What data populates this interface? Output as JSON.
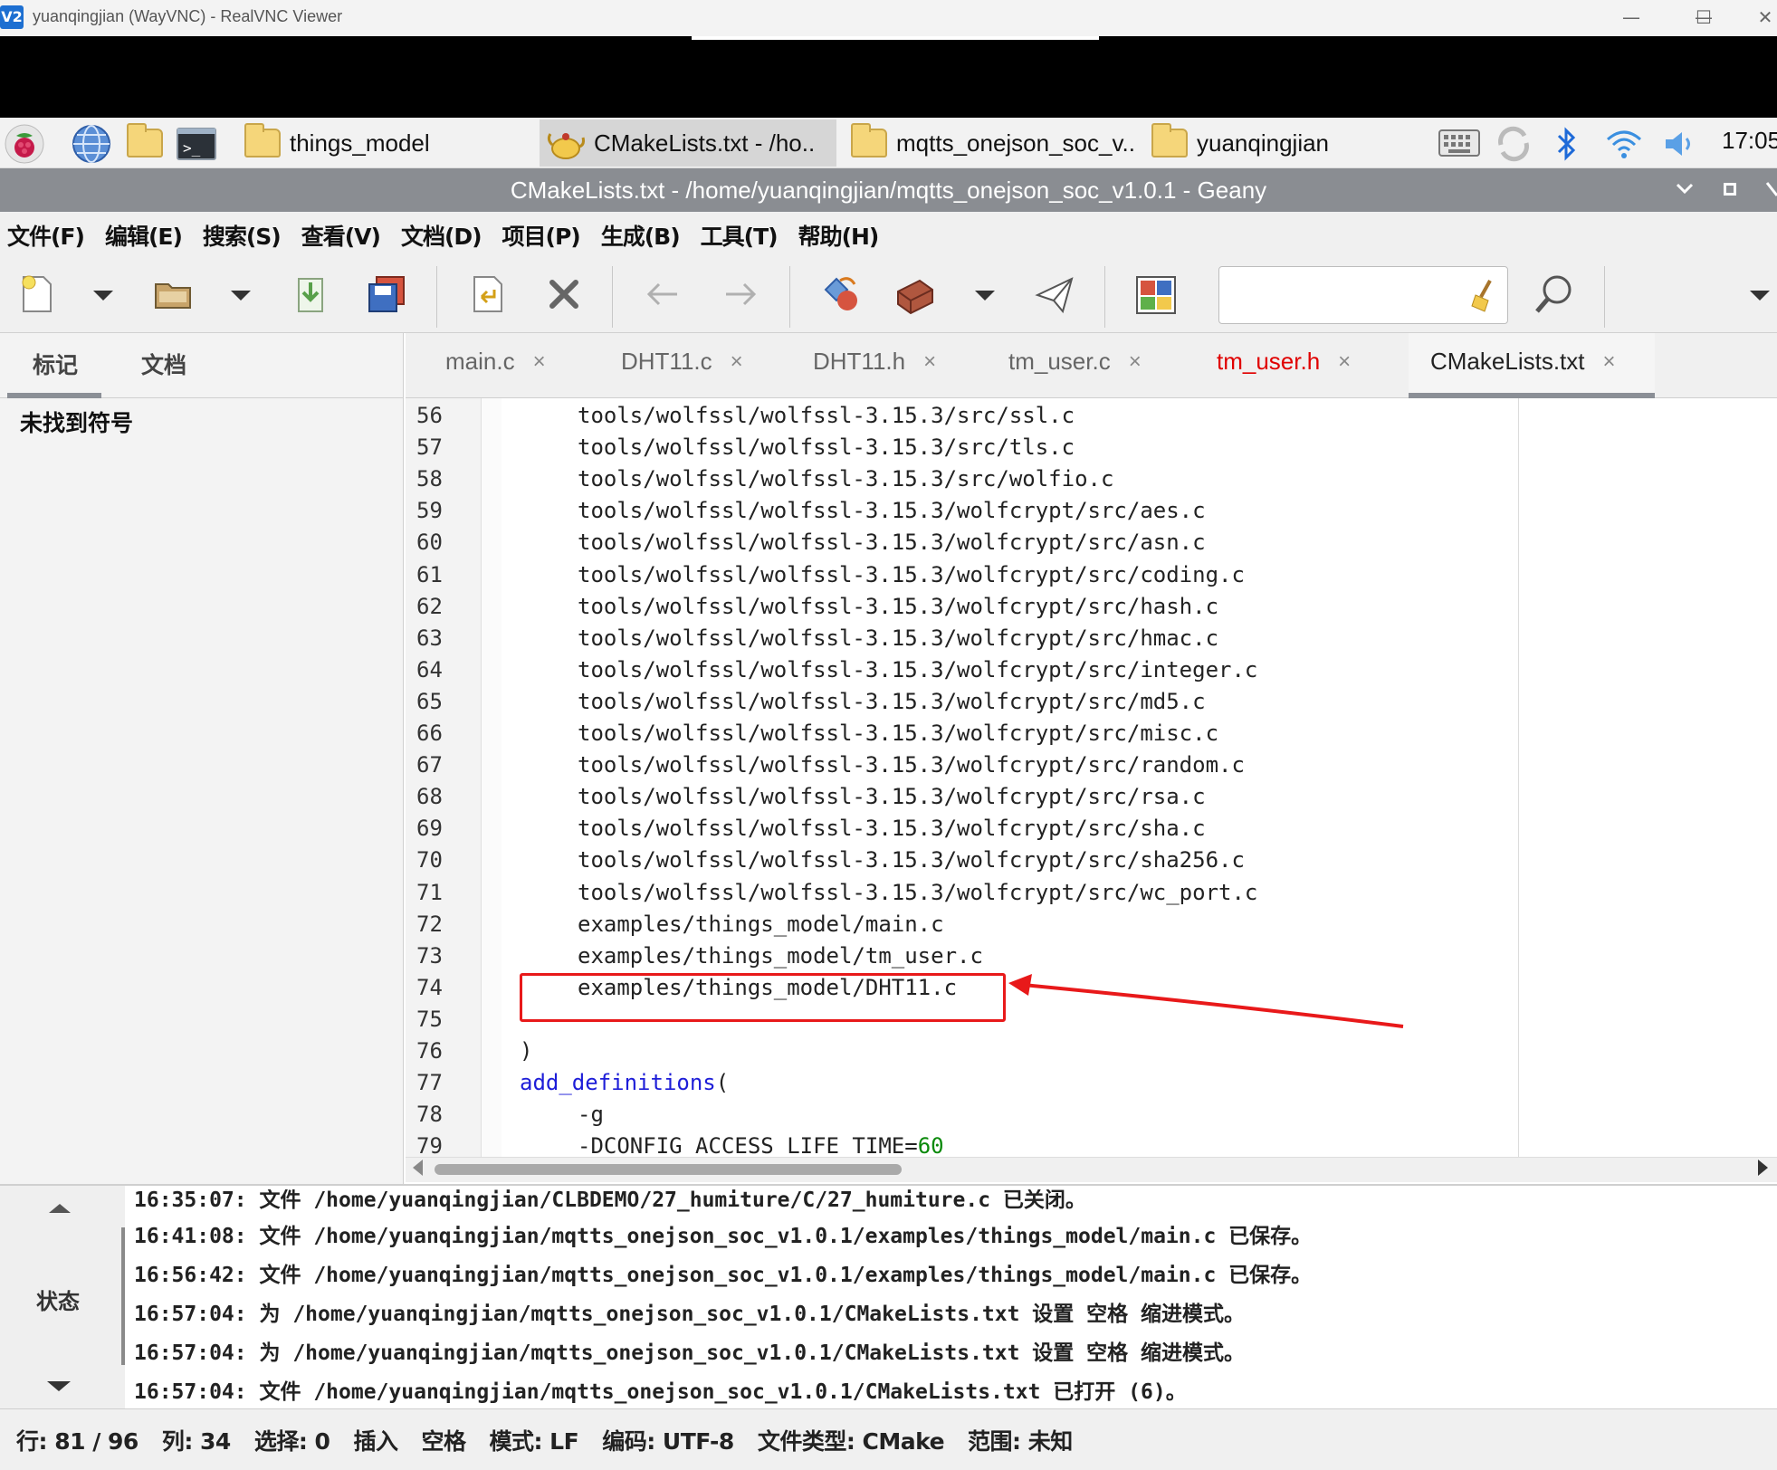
{
  "vnc": {
    "logo": "V2",
    "title": "yuanqingjian (WayVNC) - RealVNC Viewer",
    "min": "—",
    "max": "☐",
    "close": "✕"
  },
  "taskbar": {
    "items": [
      {
        "label": "things_model"
      },
      {
        "label": "CMakeLists.txt - /ho.."
      },
      {
        "label": "mqtts_onejson_soc_v.."
      },
      {
        "label": "yuanqingjian"
      }
    ],
    "clock": "17:05",
    "colors": {
      "raspberry": "#c51a4a",
      "bluetooth": "#1e6ad8"
    }
  },
  "geany": {
    "title": "CMakeLists.txt - /home/yuanqingjian/mqtts_onejson_soc_v1.0.1 - Geany",
    "menu": [
      "文件(F)",
      "编辑(E)",
      "搜索(S)",
      "查看(V)",
      "文档(D)",
      "项目(P)",
      "生成(B)",
      "工具(T)",
      "帮助(H)"
    ],
    "search": {
      "value": ""
    }
  },
  "side": {
    "tabs": [
      "标记",
      "文档"
    ],
    "empty_text": "未找到符号"
  },
  "editor": {
    "tabs": [
      {
        "label": "main.c",
        "state": "normal"
      },
      {
        "label": "DHT11.c",
        "state": "normal"
      },
      {
        "label": "DHT11.h",
        "state": "normal"
      },
      {
        "label": "tm_user.c",
        "state": "normal"
      },
      {
        "label": "tm_user.h",
        "state": "modified"
      },
      {
        "label": "CMakeLists.txt",
        "state": "active"
      }
    ],
    "close_glyph": "×",
    "lines": [
      {
        "n": "56",
        "text": "tools/wolfssl/wolfssl-3.15.3/src/ssl.c",
        "indent": 1
      },
      {
        "n": "57",
        "text": "tools/wolfssl/wolfssl-3.15.3/src/tls.c",
        "indent": 1
      },
      {
        "n": "58",
        "text": "tools/wolfssl/wolfssl-3.15.3/src/wolfio.c",
        "indent": 1
      },
      {
        "n": "59",
        "text": "tools/wolfssl/wolfssl-3.15.3/wolfcrypt/src/aes.c",
        "indent": 1
      },
      {
        "n": "60",
        "text": "tools/wolfssl/wolfssl-3.15.3/wolfcrypt/src/asn.c",
        "indent": 1
      },
      {
        "n": "61",
        "text": "tools/wolfssl/wolfssl-3.15.3/wolfcrypt/src/coding.c",
        "indent": 1
      },
      {
        "n": "62",
        "text": "tools/wolfssl/wolfssl-3.15.3/wolfcrypt/src/hash.c",
        "indent": 1
      },
      {
        "n": "63",
        "text": "tools/wolfssl/wolfssl-3.15.3/wolfcrypt/src/hmac.c",
        "indent": 1
      },
      {
        "n": "64",
        "text": "tools/wolfssl/wolfssl-3.15.3/wolfcrypt/src/integer.c",
        "indent": 1
      },
      {
        "n": "65",
        "text": "tools/wolfssl/wolfssl-3.15.3/wolfcrypt/src/md5.c",
        "indent": 1
      },
      {
        "n": "66",
        "text": "tools/wolfssl/wolfssl-3.15.3/wolfcrypt/src/misc.c",
        "indent": 1
      },
      {
        "n": "67",
        "text": "tools/wolfssl/wolfssl-3.15.3/wolfcrypt/src/random.c",
        "indent": 1
      },
      {
        "n": "68",
        "text": "tools/wolfssl/wolfssl-3.15.3/wolfcrypt/src/rsa.c",
        "indent": 1
      },
      {
        "n": "69",
        "text": "tools/wolfssl/wolfssl-3.15.3/wolfcrypt/src/sha.c",
        "indent": 1
      },
      {
        "n": "70",
        "text": "tools/wolfssl/wolfssl-3.15.3/wolfcrypt/src/sha256.c",
        "indent": 1
      },
      {
        "n": "71",
        "text": "tools/wolfssl/wolfssl-3.15.3/wolfcrypt/src/wc_port.c",
        "indent": 1
      },
      {
        "n": "72",
        "text": "examples/things_model/main.c",
        "indent": 1
      },
      {
        "n": "73",
        "text": "examples/things_model/tm_user.c",
        "indent": 1
      },
      {
        "n": "74",
        "text": "examples/things_model/DHT11.c",
        "indent": 1
      },
      {
        "n": "75",
        "text": "",
        "indent": 1
      },
      {
        "n": "76",
        "text": ")",
        "indent": 0
      },
      {
        "n": "77",
        "kw": "add_definitions",
        "text": "(",
        "indent": 0
      },
      {
        "n": "78",
        "text": "-g",
        "indent": 1
      },
      {
        "n": "79",
        "text": "-DCONFIG_ACCESS_LIFE_TIME=",
        "num": "60",
        "indent": 1
      }
    ],
    "colors": {
      "keyword": "#1d1dd8",
      "number": "#0b8a0b",
      "modified_tab": "#e00000",
      "annotation": "#e8191a"
    }
  },
  "messages": {
    "side_label": "状态",
    "lines": [
      "16:35:07: 文件 /home/yuanqingjian/CLBDEMO/27_humiture/C/27_humiture.c 已关闭。",
      "16:41:08: 文件 /home/yuanqingjian/mqtts_onejson_soc_v1.0.1/examples/things_model/main.c 已保存。",
      "16:56:42: 文件 /home/yuanqingjian/mqtts_onejson_soc_v1.0.1/examples/things_model/main.c 已保存。",
      "16:57:04: 为 /home/yuanqingjian/mqtts_onejson_soc_v1.0.1/CMakeLists.txt 设置 空格 缩进模式。",
      "16:57:04: 为 /home/yuanqingjian/mqtts_onejson_soc_v1.0.1/CMakeLists.txt 设置 空格 缩进模式。",
      "16:57:04: 文件 /home/yuanqingjian/mqtts_onejson_soc_v1.0.1/CMakeLists.txt 已打开 (6)。"
    ]
  },
  "status": {
    "items": [
      "行: 81 / 96",
      "列: 34",
      "选择: 0",
      "插入",
      "空格",
      "模式: LF",
      "编码: UTF-8",
      "文件类型: CMake",
      "范围: 未知"
    ]
  }
}
